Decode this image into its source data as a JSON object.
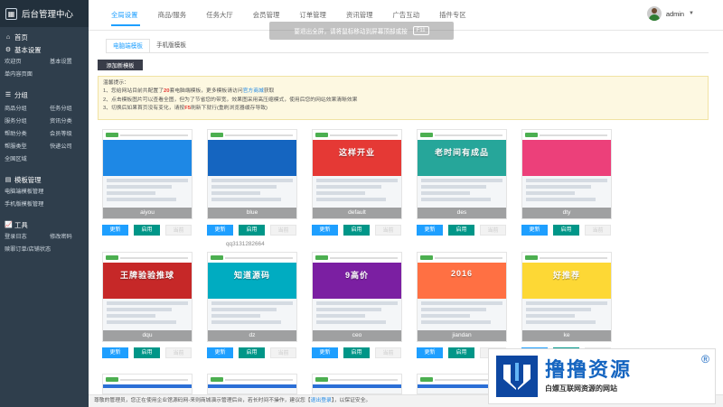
{
  "brand": {
    "logo": "▦",
    "title": "后台管理中心"
  },
  "sidebar": {
    "home": {
      "icon": "home-icon",
      "label": "首页"
    },
    "sections": [
      {
        "title": "基本设置",
        "icon": "gear-icon",
        "items": [
          "欢迎页",
          "基本设置",
          "单内容页面"
        ]
      },
      {
        "title": "分组",
        "icon": "list-icon",
        "items": [
          "商品分组",
          "任务分组",
          "服务分组",
          "资讯分类",
          "帮助分类",
          "会员等级",
          "帮服类型",
          "快递公司",
          "全国区域"
        ]
      },
      {
        "title": "模板管理",
        "icon": "template-icon",
        "items": [
          "电脑端模板管理",
          "手机版模板管理"
        ]
      },
      {
        "title": "工具",
        "icon": "chart-icon",
        "items": [
          "登录日志",
          "修改密码",
          "赎罪订单/店铺状态"
        ]
      }
    ]
  },
  "topnav": [
    "全局设置",
    "商品/服务",
    "任务大厅",
    "会员管理",
    "订单管理",
    "资讯管理",
    "广告互动",
    "插件专区"
  ],
  "user": {
    "name": "admin",
    "caret": "▼"
  },
  "fullscreen_notice": {
    "text": "要退出全屏，请将鼠标移动到屏幕顶部或按",
    "key": "F11"
  },
  "subtabs": [
    "电脑端模板",
    "手机版模板"
  ],
  "add_button": "添加新模板",
  "tips": {
    "title": "温馨提示：",
    "line1_a": "1、您给网站目前共配置了",
    "line1_count": "20",
    "line1_b": "套电脑端模板，更多模板请访问",
    "line1_link": "官方商城",
    "line1_c": "获取",
    "line2": "2、点击模板图片可以查看全图，但为了节省您的带宽，效果图采用高压缩模式，使用后您的网站效果清晰效果",
    "line3_a": "3、切换后如果首页没有变化，请按",
    "line3_key": "F5",
    "line3_b": "刷新下就行(重刷浏览器缓存导致)"
  },
  "template_buttons": {
    "update": "更新",
    "enable": "启用",
    "current": "当前"
  },
  "templates": [
    {
      "name": "aiyou",
      "color": "#1e88e5",
      "banner": ""
    },
    {
      "name": "blue",
      "color": "#1565c0",
      "banner": ""
    },
    {
      "name": "default",
      "color": "#e53935",
      "banner": "这样开业"
    },
    {
      "name": "des",
      "color": "#26a69a",
      "banner": "老时间有成品"
    },
    {
      "name": "dty",
      "color": "#ec407a",
      "banner": ""
    },
    {
      "name": "dqu",
      "color": "#c62828",
      "banner": "王牌验验推球"
    },
    {
      "name": "dz",
      "color": "#00acc1",
      "banner": "知道源码"
    },
    {
      "name": "ceo",
      "color": "#7b1fa2",
      "banner": "9高价"
    },
    {
      "name": "jiandan",
      "color": "#ff7043",
      "banner": "2016"
    },
    {
      "name": "ke",
      "color": "#fdd835",
      "banner": "好推荐"
    }
  ],
  "watermark": "qq3131282664",
  "footer": {
    "a": "尊敬的管理员，您正在使用企业馆源码网-来则商城演示管理后台，若长时间不操作，建议您【",
    "link": "退出登录",
    "b": "】，以保证安全。"
  },
  "badge": {
    "title": "撸撸资源",
    "subtitle": "白嫖互联网资源的网站",
    "reg": "®"
  }
}
